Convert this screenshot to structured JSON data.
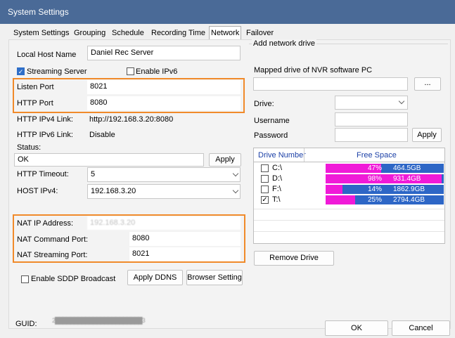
{
  "window": {
    "title": "System Settings"
  },
  "tabs": [
    "System Settings",
    "Grouping",
    "Schedule",
    "Recording Time",
    "Network",
    "Failover"
  ],
  "left": {
    "local_host_label": "Local Host Name",
    "local_host_value": "Daniel Rec Server",
    "streaming_server_label": "Streaming Server",
    "streaming_server_checked": true,
    "enable_ipv6_label": "Enable IPv6",
    "enable_ipv6_checked": false,
    "listen_port_label": "Listen Port",
    "listen_port_value": "8021",
    "http_port_label": "HTTP Port",
    "http_port_value": "8080",
    "ipv4_link_label": "HTTP IPv4 Link:",
    "ipv4_link_value": "http://192.168.3.20:8080",
    "ipv6_link_label": "HTTP IPv6 Link:",
    "ipv6_link_value": "Disable",
    "status_label": "Status:",
    "status_value": "OK",
    "apply_label": "Apply",
    "http_timeout_label": "HTTP Timeout:",
    "http_timeout_value": "5",
    "host_ipv4_label": "HOST IPv4:",
    "host_ipv4_value": "192.168.3.20",
    "nat_ip_label": "NAT IP Address:",
    "nat_ip_value": "192.168.3.20",
    "nat_cmd_label": "NAT Command Port:",
    "nat_cmd_value": "8080",
    "nat_stream_label": "NAT Streaming Port:",
    "nat_stream_value": "8021",
    "sddp_label": "Enable SDDP Broadcast",
    "sddp_checked": false,
    "apply_ddns_label": "Apply DDNS",
    "browser_setting_label": "Browser Setting"
  },
  "right": {
    "group_title": "Add network drive",
    "mapped_label": "Mapped drive of NVR software PC",
    "browse_label": "...",
    "drive_label": "Drive:",
    "username_label": "Username",
    "password_label": "Password",
    "apply_label": "Apply",
    "col_drive": "Drive Number",
    "col_space": "Free Space",
    "drives": [
      {
        "name": "C:\\",
        "checked": false,
        "percent": 47,
        "pct_label": "47%",
        "size": "464.5GB"
      },
      {
        "name": "D:\\",
        "checked": false,
        "percent": 98,
        "pct_label": "98%",
        "size": "931.4GB"
      },
      {
        "name": "F:\\",
        "checked": false,
        "percent": 14,
        "pct_label": "14%",
        "size": "1862.9GB"
      },
      {
        "name": "T:\\",
        "checked": true,
        "percent": 25,
        "pct_label": "25%",
        "size": "2794.4GB"
      }
    ],
    "remove_drive_label": "Remove Drive"
  },
  "footer": {
    "guid_label": "GUID:",
    "guid_value": "2███████████████████████3",
    "ok_label": "OK",
    "cancel_label": "Cancel"
  },
  "colors": {
    "highlight": "#f08a2a",
    "bar_used": "#f01ad8",
    "bar_free": "#2d66c6",
    "titlebar": "#4a6a97"
  }
}
